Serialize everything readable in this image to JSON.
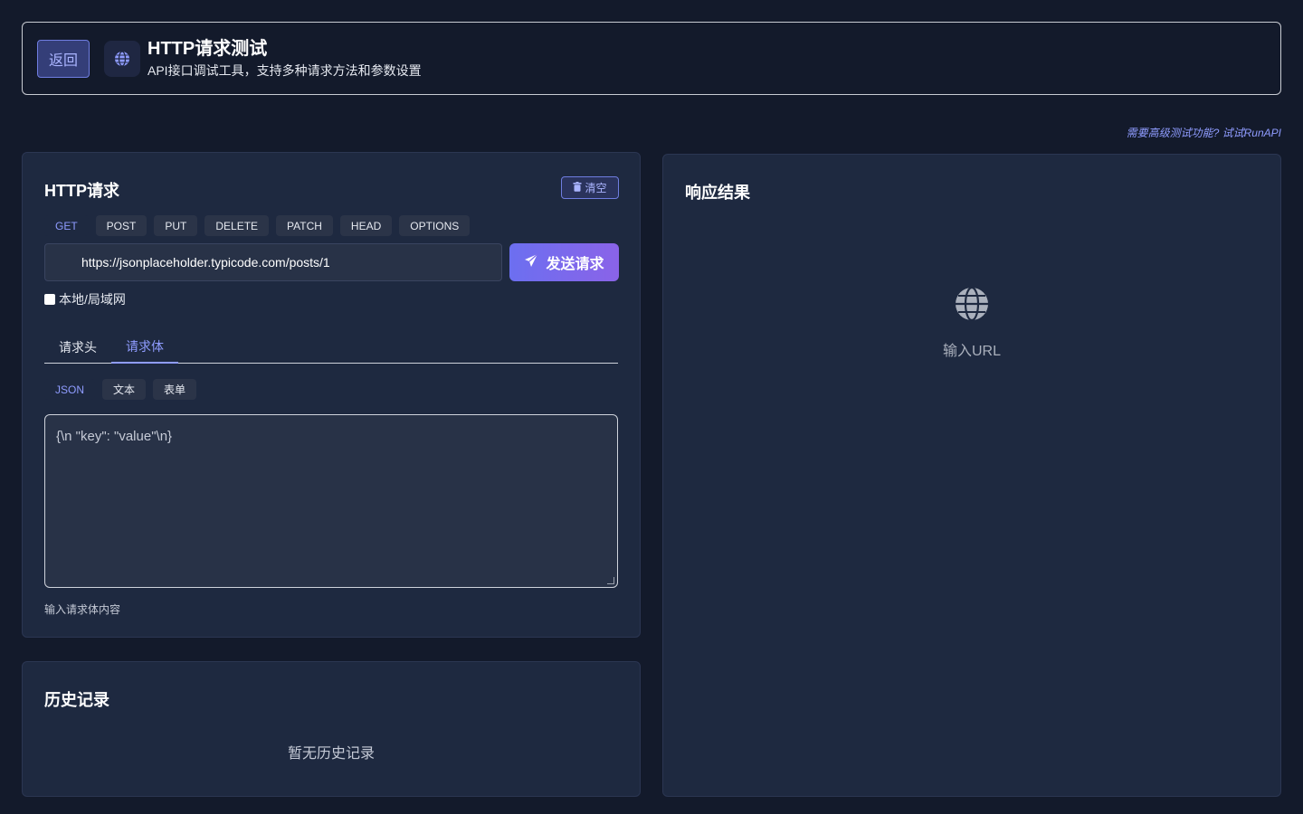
{
  "header": {
    "back_label": "返回",
    "globe_icon": "globe-icon",
    "title": "HTTP请求测试",
    "subtitle": "API接口调试工具，支持多种请求方法和参数设置"
  },
  "runapi_link": "需要高级测试功能? 试试RunAPI",
  "request": {
    "title": "HTTP请求",
    "clear_label": "清空",
    "clear_icon": "trash-icon",
    "methods": [
      "GET",
      "POST",
      "PUT",
      "DELETE",
      "PATCH",
      "HEAD",
      "OPTIONS"
    ],
    "selected_method": "GET",
    "url": "https://jsonplaceholder.typicode.com/posts/1",
    "send_label": "发送请求",
    "send_icon": "paper-plane-icon",
    "local_label": "本地/局域网",
    "local_checked": false,
    "tabs": [
      "请求头",
      "请求体"
    ],
    "active_tab": "请求体",
    "body_types": [
      "JSON",
      "文本",
      "表单"
    ],
    "active_body_type": "JSON",
    "body_placeholder": "{\\n  \"key\": \"value\"\\n}",
    "body_hint": "输入请求体内容"
  },
  "history": {
    "title": "历史记录",
    "empty_text": "暂无历史记录"
  },
  "response": {
    "title": "响应结果",
    "empty_icon": "globe-icon",
    "empty_text": "输入URL"
  },
  "colors": {
    "background": "#131a2b",
    "card": "#1e2940",
    "accent": "#8f9cff",
    "send_gradient_start": "#6c6ff0",
    "send_gradient_end": "#8a63e8"
  }
}
